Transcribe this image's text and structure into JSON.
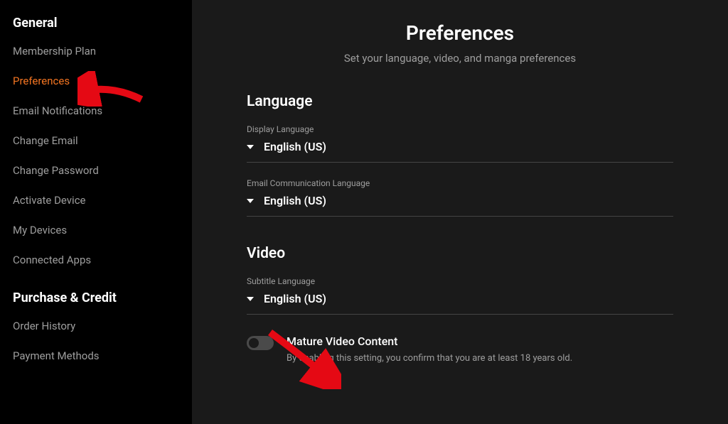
{
  "sidebar": {
    "groups": [
      {
        "title": "General",
        "items": [
          {
            "label": "Membership Plan",
            "active": false
          },
          {
            "label": "Preferences",
            "active": true
          },
          {
            "label": "Email Notifications",
            "active": false
          },
          {
            "label": "Change Email",
            "active": false
          },
          {
            "label": "Change Password",
            "active": false
          },
          {
            "label": "Activate Device",
            "active": false
          },
          {
            "label": "My Devices",
            "active": false
          },
          {
            "label": "Connected Apps",
            "active": false
          }
        ]
      },
      {
        "title": "Purchase & Credit",
        "items": [
          {
            "label": "Order History",
            "active": false
          },
          {
            "label": "Payment Methods",
            "active": false
          }
        ]
      }
    ]
  },
  "page": {
    "title": "Preferences",
    "subtitle": "Set your language, video, and manga preferences"
  },
  "sections": {
    "language": {
      "title": "Language",
      "display": {
        "label": "Display Language",
        "value": "English (US)"
      },
      "email": {
        "label": "Email Communication Language",
        "value": "English (US)"
      }
    },
    "video": {
      "title": "Video",
      "subtitle": {
        "label": "Subtitle Language",
        "value": "English (US)"
      },
      "mature": {
        "title": "Mature Video Content",
        "description": "By enabling this setting, you confirm that you are at least 18 years old."
      }
    }
  },
  "colors": {
    "accent": "#f47521",
    "arrow": "#e50914"
  }
}
